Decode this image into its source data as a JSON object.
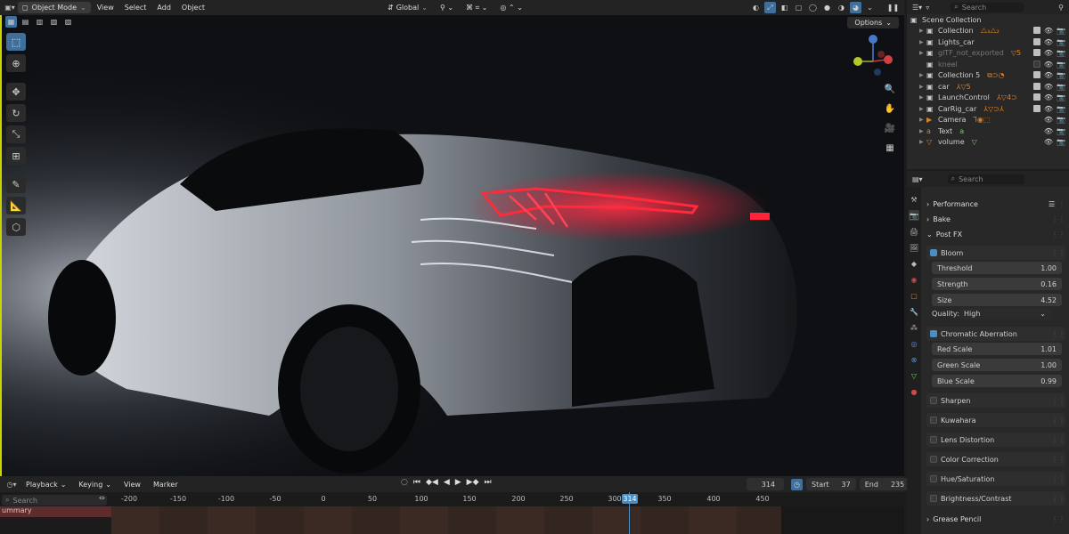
{
  "header": {
    "mode": "Object Mode",
    "menus": [
      "View",
      "Select",
      "Add",
      "Object"
    ],
    "orientation": "Global",
    "options_label": "Options"
  },
  "outliner": {
    "search_placeholder": "Search",
    "root": "Scene Collection",
    "rows": [
      {
        "name": "Collection",
        "extras": "",
        "enabled": true,
        "dim": false
      },
      {
        "name": "Lights_car",
        "extras": "",
        "enabled": true,
        "dim": false
      },
      {
        "name": "glTF_not_exported",
        "extras": "5",
        "enabled": true,
        "dim": true
      },
      {
        "name": "kneel",
        "extras": "",
        "enabled": false,
        "dim": true
      },
      {
        "name": "Collection 5",
        "extras": "",
        "enabled": true,
        "dim": false
      },
      {
        "name": "car",
        "extras": "5",
        "enabled": true,
        "dim": false
      },
      {
        "name": "LaunchControl",
        "extras": "4",
        "enabled": true,
        "dim": false
      },
      {
        "name": "CarRig_car",
        "extras": "",
        "enabled": true,
        "dim": false
      },
      {
        "name": "Camera",
        "extras": "",
        "enabled": true,
        "dim": false
      },
      {
        "name": "Text",
        "extras": "a",
        "enabled": true,
        "dim": false
      },
      {
        "name": "volume",
        "extras": "",
        "enabled": true,
        "dim": false
      }
    ]
  },
  "properties": {
    "search_placeholder": "Search",
    "panels": {
      "performance": "Performance",
      "bake": "Bake",
      "post_fx": "Post FX",
      "grease_pencil": "Grease Pencil"
    },
    "bloom": {
      "label": "Bloom",
      "threshold_label": "Threshold",
      "threshold": "1.00",
      "strength_label": "Strength",
      "strength": "0.16",
      "size_label": "Size",
      "size": "4.52",
      "quality_label": "Quality:",
      "quality": "High"
    },
    "chromatic": {
      "label": "Chromatic Aberration",
      "red_label": "Red Scale",
      "red": "1.01",
      "green_label": "Green Scale",
      "green": "1.00",
      "blue_label": "Blue Scale",
      "blue": "0.99"
    },
    "effects": [
      "Sharpen",
      "Kuwahara",
      "Lens Distortion",
      "Color Correction",
      "Hue/Saturation",
      "Brightness/Contrast"
    ]
  },
  "timeline": {
    "menus": [
      "Playback",
      "Keying",
      "View",
      "Marker"
    ],
    "search_placeholder": "Search",
    "current_frame": "314",
    "start_label": "Start",
    "start": "37",
    "end_label": "End",
    "end": "235",
    "summary_label": "ummary",
    "ticks": [
      "-200",
      "-150",
      "-100",
      "-50",
      "0",
      "50",
      "100",
      "150",
      "200",
      "250",
      "300",
      "350",
      "400",
      "450"
    ]
  }
}
